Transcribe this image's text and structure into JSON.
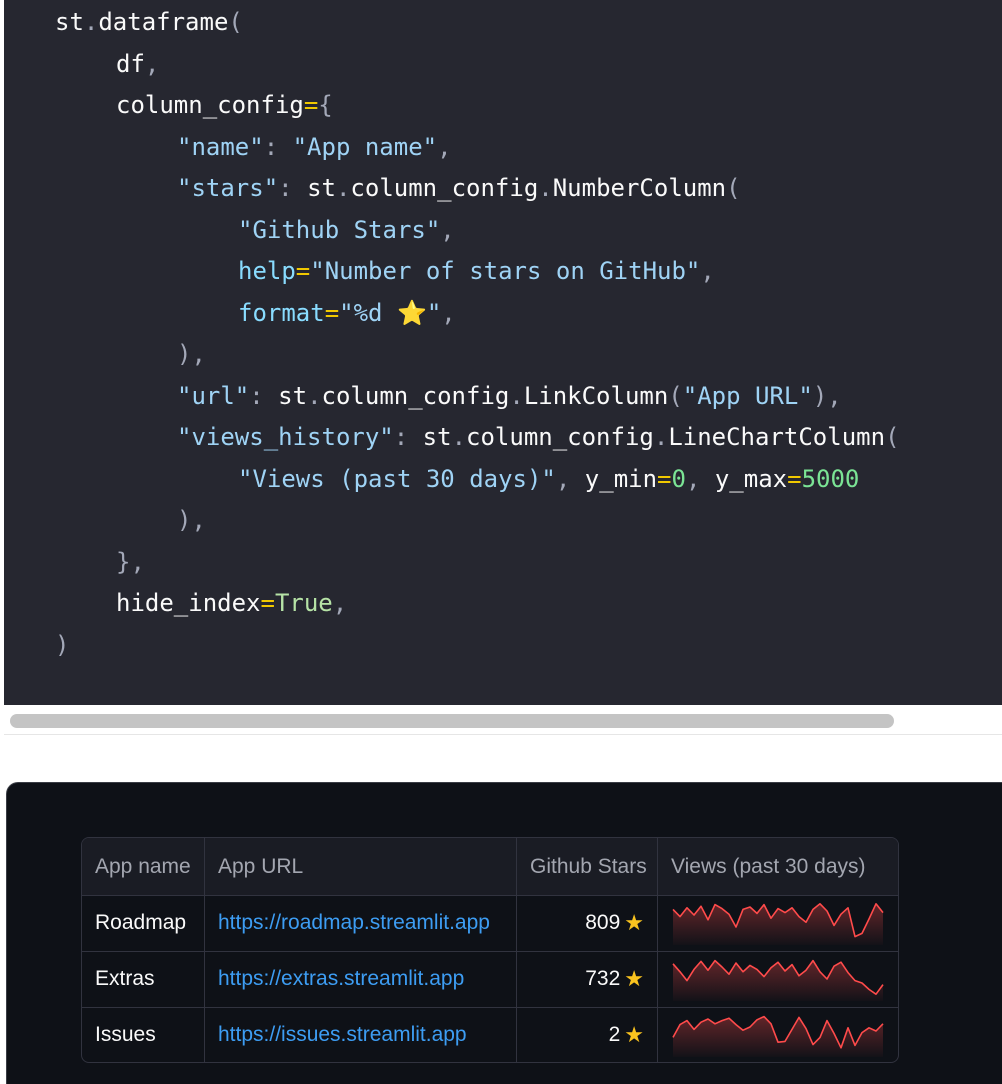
{
  "code": {
    "lines": [
      {
        "indent": 0,
        "tokens": [
          [
            "fn",
            "st"
          ],
          [
            "pun",
            "."
          ],
          [
            "fn",
            "dataframe"
          ],
          [
            "pun",
            "("
          ]
        ]
      },
      {
        "indent": 1,
        "tokens": [
          [
            "fn",
            "df"
          ],
          [
            "pun",
            ","
          ]
        ]
      },
      {
        "indent": 1,
        "tokens": [
          [
            "fn",
            "column_config"
          ],
          [
            "eq",
            "="
          ],
          [
            "pun",
            "{"
          ]
        ]
      },
      {
        "indent": 2,
        "tokens": [
          [
            "str",
            "\"name\""
          ],
          [
            "pun",
            ": "
          ],
          [
            "str",
            "\"App name\""
          ],
          [
            "pun",
            ","
          ]
        ]
      },
      {
        "indent": 2,
        "tokens": [
          [
            "str",
            "\"stars\""
          ],
          [
            "pun",
            ": "
          ],
          [
            "fn",
            "st"
          ],
          [
            "pun",
            "."
          ],
          [
            "fn",
            "column_config"
          ],
          [
            "pun",
            "."
          ],
          [
            "fn",
            "NumberColumn"
          ],
          [
            "pun",
            "("
          ]
        ]
      },
      {
        "indent": 3,
        "tokens": [
          [
            "str",
            "\"Github Stars\""
          ],
          [
            "pun",
            ","
          ]
        ]
      },
      {
        "indent": 3,
        "tokens": [
          [
            "kw",
            "help"
          ],
          [
            "eq",
            "="
          ],
          [
            "str",
            "\"Number of stars on GitHub\""
          ],
          [
            "pun",
            ","
          ]
        ]
      },
      {
        "indent": 3,
        "tokens": [
          [
            "kw",
            "format"
          ],
          [
            "eq",
            "="
          ],
          [
            "str",
            "\"%d ⭐\""
          ],
          [
            "pun",
            ","
          ]
        ]
      },
      {
        "indent": 2,
        "tokens": [
          [
            "pun",
            "),"
          ]
        ]
      },
      {
        "indent": 2,
        "tokens": [
          [
            "str",
            "\"url\""
          ],
          [
            "pun",
            ": "
          ],
          [
            "fn",
            "st"
          ],
          [
            "pun",
            "."
          ],
          [
            "fn",
            "column_config"
          ],
          [
            "pun",
            "."
          ],
          [
            "fn",
            "LinkColumn"
          ],
          [
            "pun",
            "("
          ],
          [
            "str",
            "\"App URL\""
          ],
          [
            "pun",
            "),"
          ]
        ]
      },
      {
        "indent": 2,
        "tokens": [
          [
            "str",
            "\"views_history\""
          ],
          [
            "pun",
            ": "
          ],
          [
            "fn",
            "st"
          ],
          [
            "pun",
            "."
          ],
          [
            "fn",
            "column_config"
          ],
          [
            "pun",
            "."
          ],
          [
            "fn",
            "LineChartColumn"
          ],
          [
            "pun",
            "("
          ]
        ]
      },
      {
        "indent": 3,
        "tokens": [
          [
            "str",
            "\"Views (past 30 days)\""
          ],
          [
            "pun",
            ", "
          ],
          [
            "fn",
            "y_min"
          ],
          [
            "eq",
            "="
          ],
          [
            "num",
            "0"
          ],
          [
            "pun",
            ", "
          ],
          [
            "fn",
            "y_max"
          ],
          [
            "eq",
            "="
          ],
          [
            "num",
            "5000"
          ]
        ]
      },
      {
        "indent": 2,
        "tokens": [
          [
            "pun",
            "),"
          ]
        ]
      },
      {
        "indent": 1,
        "tokens": [
          [
            "pun",
            "},"
          ]
        ]
      },
      {
        "indent": 1,
        "tokens": [
          [
            "fn",
            "hide_index"
          ],
          [
            "eq",
            "="
          ],
          [
            "bool",
            "True"
          ],
          [
            "pun",
            ","
          ]
        ]
      },
      {
        "indent": 0,
        "tokens": [
          [
            "pun",
            ")"
          ]
        ]
      }
    ]
  },
  "table": {
    "headers": {
      "name": "App name",
      "url": "App URL",
      "stars": "Github Stars",
      "views": "Views (past 30 days)"
    },
    "rows": [
      {
        "name": "Roadmap",
        "url": "https://roadmap.streamlit.app",
        "stars": "809",
        "views": [
          4200,
          3300,
          4400,
          3500,
          4600,
          2900,
          4800,
          4300,
          3600,
          2000,
          4200,
          4500,
          3700,
          4800,
          3100,
          4300,
          3800,
          4400,
          3300,
          2600,
          4200,
          4900,
          4000,
          2200,
          3600,
          4400,
          800,
          1200,
          3000,
          4900,
          3800
        ]
      },
      {
        "name": "Extras",
        "url": "https://extras.streamlit.app",
        "stars": "732",
        "views": [
          4400,
          3400,
          2300,
          3700,
          4700,
          3600,
          4800,
          4000,
          3100,
          4500,
          3400,
          4200,
          3700,
          2800,
          3900,
          4600,
          3500,
          4300,
          2900,
          3600,
          4800,
          3400,
          2500,
          4100,
          4600,
          3300,
          2300,
          2000,
          1200,
          600,
          1800
        ]
      },
      {
        "name": "Issues",
        "url": "https://issues.streamlit.app",
        "stars": "2",
        "views": [
          2200,
          3800,
          4300,
          3200,
          4100,
          4500,
          3900,
          4300,
          4600,
          3800,
          3100,
          3500,
          4400,
          4800,
          3900,
          1600,
          1700,
          3200,
          4700,
          3300,
          1300,
          2200,
          4300,
          2700,
          900,
          3400,
          1200,
          2800,
          3400,
          3000,
          3900
        ]
      }
    ],
    "star_glyph": "★",
    "colors": {
      "spark_line": "#ff4b4b",
      "link": "#3d9df3",
      "star": "#f9c31f"
    }
  },
  "spark": {
    "y_min": 0,
    "y_max": 5000
  }
}
